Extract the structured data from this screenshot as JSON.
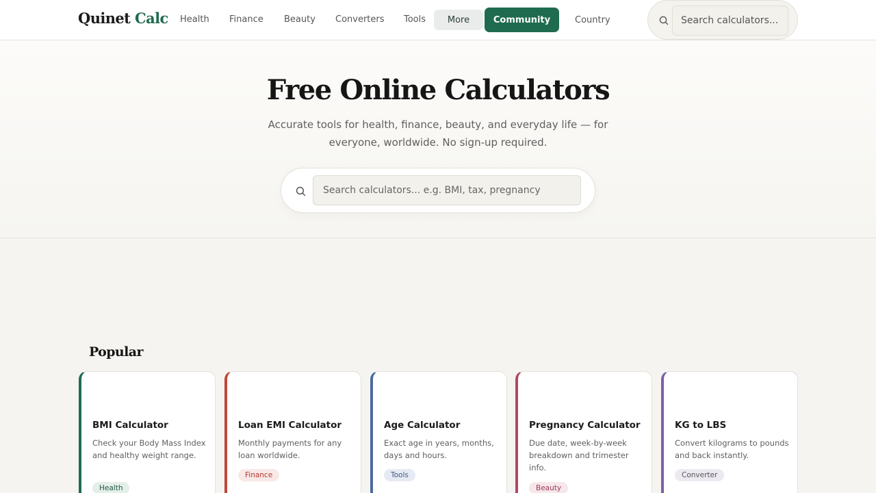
{
  "header": {
    "logo_main": "Quinet ",
    "logo_accent": "Calc",
    "nav": {
      "health": "Health",
      "finance": "Finance",
      "beauty": "Beauty",
      "converters": "Converters",
      "tools": "Tools",
      "more": "More",
      "community": "Community",
      "country": "Country"
    },
    "search_placeholder": "Search calculators..."
  },
  "hero": {
    "title": "Free Online Calculators",
    "subtitle": "Accurate tools for health, finance, beauty, and everyday life — for everyone, worldwide. No sign-up required.",
    "search_placeholder": "Search calculators... e.g. BMI, tax, pregnancy"
  },
  "popular": {
    "title": "Popular",
    "cards": [
      {
        "name": "BMI Calculator",
        "desc": "Check your Body Mass Index and healthy weight range.",
        "tag": "Health",
        "accent": "#1f6b4f",
        "tag_bg": "#e5efea",
        "tag_color": "#1f5a43"
      },
      {
        "name": "Loan EMI Calculator",
        "desc": "Monthly payments for any loan worldwide.",
        "tag": "Finance",
        "accent": "#c0453a",
        "tag_bg": "#f8e8e6",
        "tag_color": "#b23a30"
      },
      {
        "name": "Age Calculator",
        "desc": "Exact age in years, months, days and hours.",
        "tag": "Tools",
        "accent": "#4a6aa0",
        "tag_bg": "#e6ebf3",
        "tag_color": "#3d5a88"
      },
      {
        "name": "Pregnancy Calculator",
        "desc": "Due date, week-by-week breakdown and trimester info.",
        "tag": "Beauty",
        "accent": "#b04766",
        "tag_bg": "#f6e7eb",
        "tag_color": "#9c3b58"
      },
      {
        "name": "KG to LBS",
        "desc": "Convert kilograms to pounds and back instantly.",
        "tag": "Converter",
        "accent": "#7b5ea7",
        "tag_bg": "#eceaf0",
        "tag_color": "#555"
      }
    ]
  },
  "icons": {
    "header_search": "search-icon",
    "hero_search": "search-icon"
  }
}
